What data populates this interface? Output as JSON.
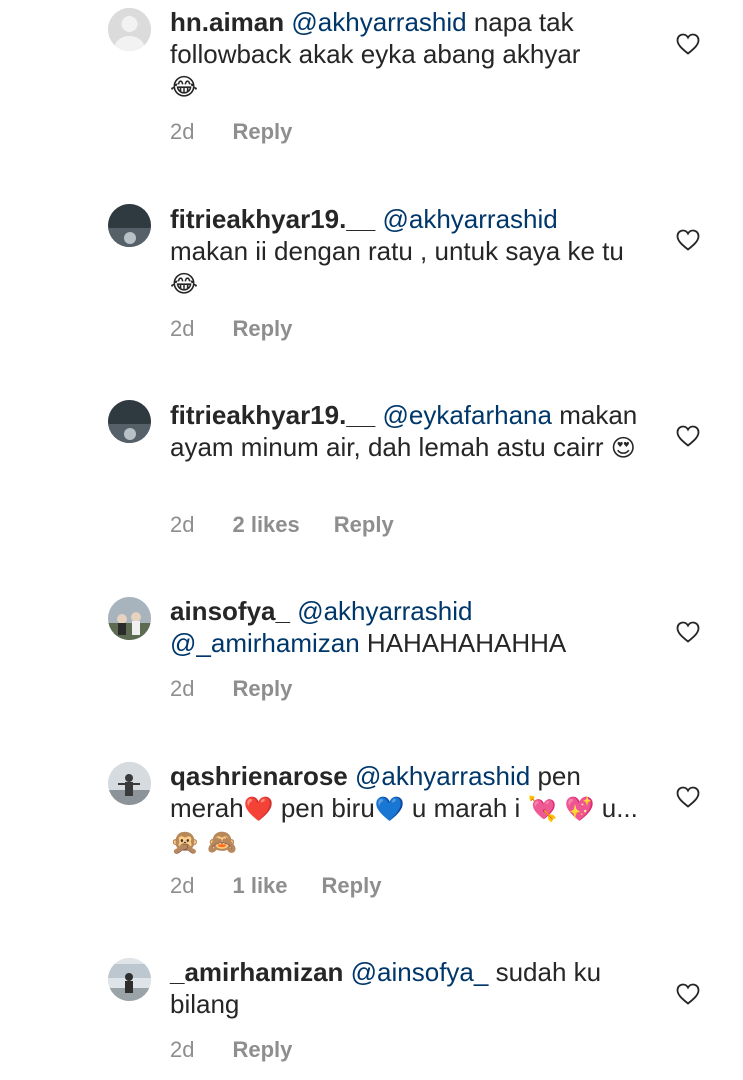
{
  "comments": [
    {
      "username": "hn.aiman",
      "mention": "@akhyarrashid",
      "text": " napa tak followback akak eyka abang akhyar",
      "emoji": "😂",
      "time": "2d",
      "likes": "",
      "reply": "Reply",
      "avatar": "default-avatar"
    },
    {
      "username": "fitrieakhyar19.__",
      "mention": "@akhyarrashid",
      "text": " makan ii dengan ratu , untuk saya ke tu ",
      "emoji": "😂",
      "time": "2d",
      "likes": "",
      "reply": "Reply",
      "avatar": "dark-photo"
    },
    {
      "username": "fitrieakhyar19.__",
      "mention": "@eykafarhana",
      "text": " makan ayam minum air, dah lemah astu cairr ",
      "emoji": "😍",
      "time": "2d",
      "likes": "2 likes",
      "reply": "Reply",
      "avatar": "dark-photo"
    },
    {
      "username": "ainsofya_",
      "mention": "@akhyarrashid",
      "mention2": "@_amirhamizan",
      "text": " HAHAHAHAHHA",
      "emoji": "",
      "time": "2d",
      "likes": "",
      "reply": "Reply",
      "avatar": "group-photo"
    },
    {
      "username": "qashrienarose",
      "mention": "@akhyarrashid",
      "text_parts": [
        " pen merah",
        "❤️",
        " pen biru",
        "💙",
        " u marah i ",
        "💘",
        " ",
        "💖",
        " u... ",
        "🙊",
        " ",
        "🙈"
      ],
      "time": "2d",
      "likes": "1 like",
      "reply": "Reply",
      "avatar": "person-photo"
    },
    {
      "username": "_amirhamizan",
      "mention": "@ainsofya_",
      "text": " sudah ku bilang",
      "emoji": "",
      "time": "2d",
      "likes": "",
      "reply": "Reply",
      "avatar": "person-photo-2"
    }
  ],
  "icons": {
    "heart": "heart-outline-icon"
  },
  "colors": {
    "text": "#262626",
    "mention": "#00376b",
    "meta": "#8e8e8e"
  }
}
